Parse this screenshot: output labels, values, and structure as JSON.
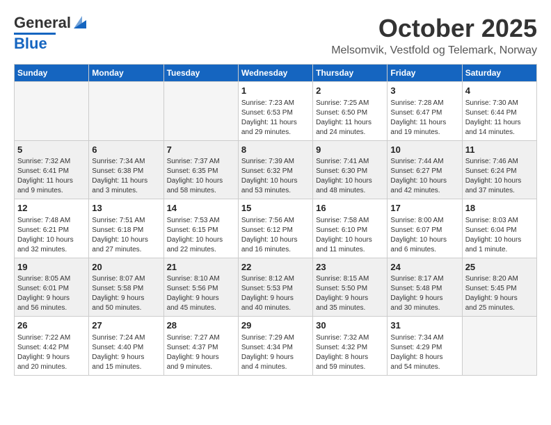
{
  "header": {
    "logo_line1": "General",
    "logo_line2": "Blue",
    "month": "October 2025",
    "location": "Melsomvik, Vestfold og Telemark, Norway"
  },
  "days_of_week": [
    "Sunday",
    "Monday",
    "Tuesday",
    "Wednesday",
    "Thursday",
    "Friday",
    "Saturday"
  ],
  "weeks": [
    [
      {
        "day": "",
        "info": ""
      },
      {
        "day": "",
        "info": ""
      },
      {
        "day": "",
        "info": ""
      },
      {
        "day": "1",
        "info": "Sunrise: 7:23 AM\nSunset: 6:53 PM\nDaylight: 11 hours\nand 29 minutes."
      },
      {
        "day": "2",
        "info": "Sunrise: 7:25 AM\nSunset: 6:50 PM\nDaylight: 11 hours\nand 24 minutes."
      },
      {
        "day": "3",
        "info": "Sunrise: 7:28 AM\nSunset: 6:47 PM\nDaylight: 11 hours\nand 19 minutes."
      },
      {
        "day": "4",
        "info": "Sunrise: 7:30 AM\nSunset: 6:44 PM\nDaylight: 11 hours\nand 14 minutes."
      }
    ],
    [
      {
        "day": "5",
        "info": "Sunrise: 7:32 AM\nSunset: 6:41 PM\nDaylight: 11 hours\nand 9 minutes."
      },
      {
        "day": "6",
        "info": "Sunrise: 7:34 AM\nSunset: 6:38 PM\nDaylight: 11 hours\nand 3 minutes."
      },
      {
        "day": "7",
        "info": "Sunrise: 7:37 AM\nSunset: 6:35 PM\nDaylight: 10 hours\nand 58 minutes."
      },
      {
        "day": "8",
        "info": "Sunrise: 7:39 AM\nSunset: 6:32 PM\nDaylight: 10 hours\nand 53 minutes."
      },
      {
        "day": "9",
        "info": "Sunrise: 7:41 AM\nSunset: 6:30 PM\nDaylight: 10 hours\nand 48 minutes."
      },
      {
        "day": "10",
        "info": "Sunrise: 7:44 AM\nSunset: 6:27 PM\nDaylight: 10 hours\nand 42 minutes."
      },
      {
        "day": "11",
        "info": "Sunrise: 7:46 AM\nSunset: 6:24 PM\nDaylight: 10 hours\nand 37 minutes."
      }
    ],
    [
      {
        "day": "12",
        "info": "Sunrise: 7:48 AM\nSunset: 6:21 PM\nDaylight: 10 hours\nand 32 minutes."
      },
      {
        "day": "13",
        "info": "Sunrise: 7:51 AM\nSunset: 6:18 PM\nDaylight: 10 hours\nand 27 minutes."
      },
      {
        "day": "14",
        "info": "Sunrise: 7:53 AM\nSunset: 6:15 PM\nDaylight: 10 hours\nand 22 minutes."
      },
      {
        "day": "15",
        "info": "Sunrise: 7:56 AM\nSunset: 6:12 PM\nDaylight: 10 hours\nand 16 minutes."
      },
      {
        "day": "16",
        "info": "Sunrise: 7:58 AM\nSunset: 6:10 PM\nDaylight: 10 hours\nand 11 minutes."
      },
      {
        "day": "17",
        "info": "Sunrise: 8:00 AM\nSunset: 6:07 PM\nDaylight: 10 hours\nand 6 minutes."
      },
      {
        "day": "18",
        "info": "Sunrise: 8:03 AM\nSunset: 6:04 PM\nDaylight: 10 hours\nand 1 minute."
      }
    ],
    [
      {
        "day": "19",
        "info": "Sunrise: 8:05 AM\nSunset: 6:01 PM\nDaylight: 9 hours\nand 56 minutes."
      },
      {
        "day": "20",
        "info": "Sunrise: 8:07 AM\nSunset: 5:58 PM\nDaylight: 9 hours\nand 50 minutes."
      },
      {
        "day": "21",
        "info": "Sunrise: 8:10 AM\nSunset: 5:56 PM\nDaylight: 9 hours\nand 45 minutes."
      },
      {
        "day": "22",
        "info": "Sunrise: 8:12 AM\nSunset: 5:53 PM\nDaylight: 9 hours\nand 40 minutes."
      },
      {
        "day": "23",
        "info": "Sunrise: 8:15 AM\nSunset: 5:50 PM\nDaylight: 9 hours\nand 35 minutes."
      },
      {
        "day": "24",
        "info": "Sunrise: 8:17 AM\nSunset: 5:48 PM\nDaylight: 9 hours\nand 30 minutes."
      },
      {
        "day": "25",
        "info": "Sunrise: 8:20 AM\nSunset: 5:45 PM\nDaylight: 9 hours\nand 25 minutes."
      }
    ],
    [
      {
        "day": "26",
        "info": "Sunrise: 7:22 AM\nSunset: 4:42 PM\nDaylight: 9 hours\nand 20 minutes."
      },
      {
        "day": "27",
        "info": "Sunrise: 7:24 AM\nSunset: 4:40 PM\nDaylight: 9 hours\nand 15 minutes."
      },
      {
        "day": "28",
        "info": "Sunrise: 7:27 AM\nSunset: 4:37 PM\nDaylight: 9 hours\nand 9 minutes."
      },
      {
        "day": "29",
        "info": "Sunrise: 7:29 AM\nSunset: 4:34 PM\nDaylight: 9 hours\nand 4 minutes."
      },
      {
        "day": "30",
        "info": "Sunrise: 7:32 AM\nSunset: 4:32 PM\nDaylight: 8 hours\nand 59 minutes."
      },
      {
        "day": "31",
        "info": "Sunrise: 7:34 AM\nSunset: 4:29 PM\nDaylight: 8 hours\nand 54 minutes."
      },
      {
        "day": "",
        "info": ""
      }
    ]
  ]
}
